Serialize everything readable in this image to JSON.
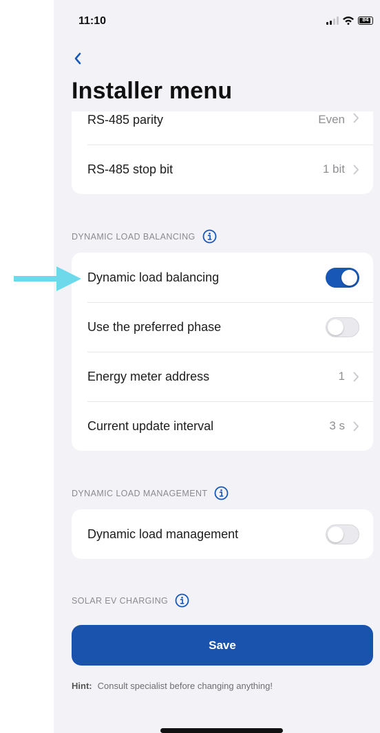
{
  "status_bar": {
    "time": "11:10",
    "battery_level": "84"
  },
  "header": {
    "title": "Installer menu"
  },
  "rs485_card": {
    "rows": [
      {
        "label": "RS-485 parity",
        "value": "Even"
      },
      {
        "label": "RS-485 stop bit",
        "value": "1 bit"
      }
    ]
  },
  "dynamic_load_balancing": {
    "header": "DYNAMIC LOAD BALANCING",
    "rows": [
      {
        "label": "Dynamic load balancing",
        "toggle": true
      },
      {
        "label": "Use the preferred phase",
        "toggle": false
      },
      {
        "label": "Energy meter address",
        "value": "1"
      },
      {
        "label": "Current update interval",
        "value": "3 s"
      }
    ]
  },
  "dynamic_load_management": {
    "header": "DYNAMIC LOAD MANAGEMENT",
    "rows": [
      {
        "label": "Dynamic load management",
        "toggle": false
      }
    ]
  },
  "solar_ev_charging": {
    "header": "SOLAR EV CHARGING"
  },
  "save_button": {
    "label": "Save"
  },
  "hint": {
    "key": "Hint:",
    "text": "Consult specialist before changing anything!"
  },
  "colors": {
    "accent": "#1a53ad",
    "toggle_on": "#1857b5",
    "arrow": "#6fd9ec",
    "background": "#f2f2f7"
  },
  "icons": [
    "back-chevron-icon",
    "chevron-right-icon",
    "info-icon",
    "arrow-icon",
    "signal-icon",
    "wifi-icon",
    "battery-icon"
  ]
}
